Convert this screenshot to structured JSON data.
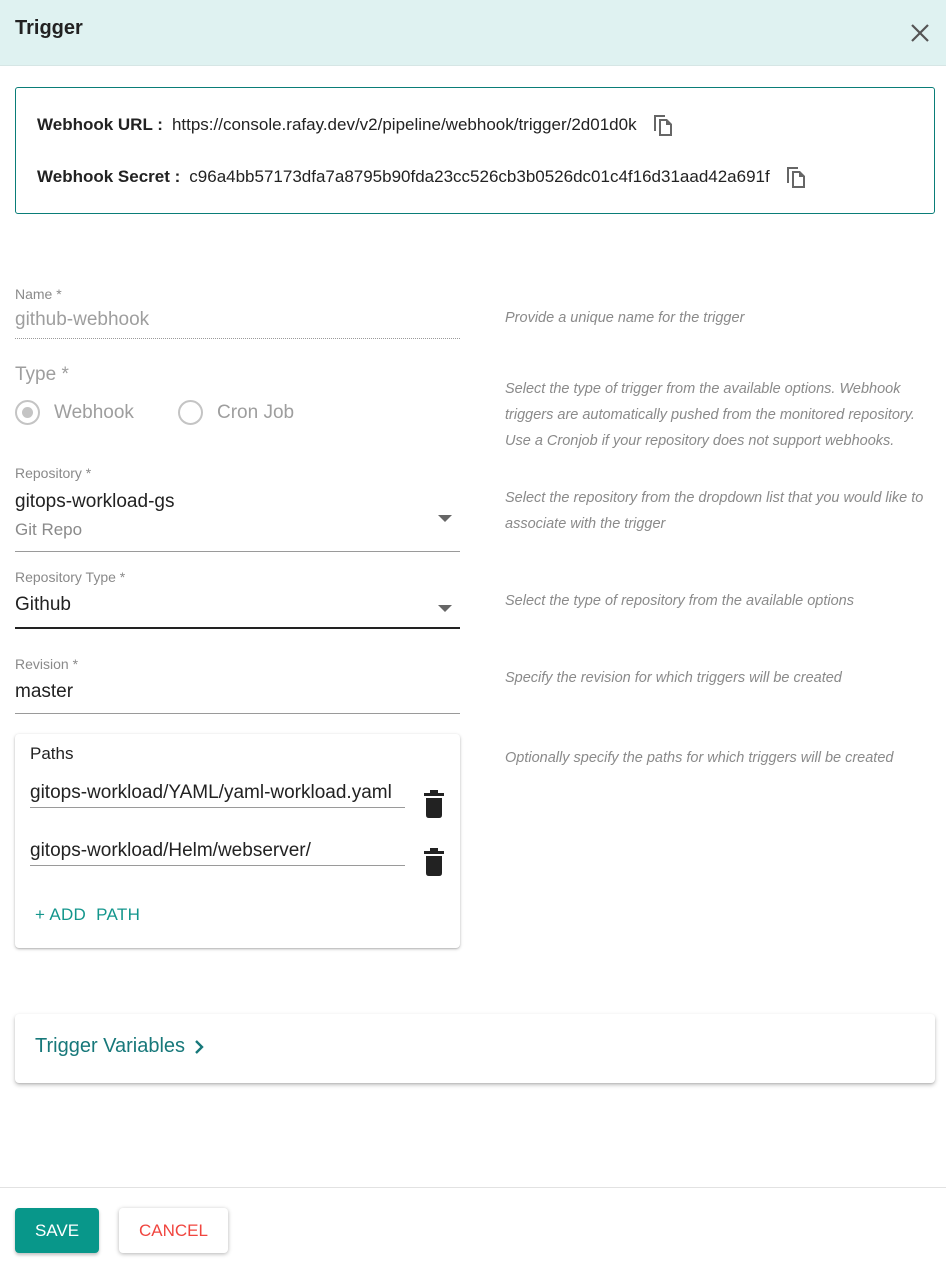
{
  "header": {
    "title": "Trigger",
    "close_icon": "close-icon"
  },
  "webhook": {
    "url_label": "Webhook URL :",
    "url_value": "https://console.rafay.dev/v2/pipeline/webhook/trigger/2d01d0k",
    "secret_label": "Webhook Secret :",
    "secret_value": "c96a4bb57173dfa7a8795b90fda23cc526cb3b0526dc01c4f16d31aad42a691f",
    "copy_icon": "copy-icon"
  },
  "form": {
    "name": {
      "label": "Name *",
      "value": "github-webhook",
      "help": "Provide a unique name for the trigger"
    },
    "type": {
      "label": "Type *",
      "options": [
        {
          "label": "Webhook",
          "checked": true
        },
        {
          "label": "Cron Job",
          "checked": false
        }
      ],
      "help": "Select the type of trigger from the available options. Webhook triggers are automatically pushed from the monitored repository. Use a Cronjob if your repository does not support webhooks."
    },
    "repository": {
      "label": "Repository *",
      "value": "gitops-workload-gs",
      "subvalue": "Git Repo",
      "help": "Select the repository from the dropdown list that you would like to associate with the trigger"
    },
    "repository_type": {
      "label": "Repository Type *",
      "value": "Github",
      "help": "Select the type of repository from the available options"
    },
    "revision": {
      "label": "Revision *",
      "value": "master",
      "help": "Specify the revision for which triggers will be created"
    },
    "paths": {
      "title": "Paths",
      "items": [
        "gitops-workload/YAML/yaml-workload.yaml",
        "gitops-workload/Helm/webserver/"
      ],
      "add_label": "+ ADD  PATH",
      "delete_icon": "trash-icon",
      "help": "Optionally specify the paths for which triggers will be created"
    }
  },
  "trigger_variables": {
    "label": "Trigger Variables",
    "icon": "chevron-right-icon"
  },
  "footer": {
    "save_label": "SAVE",
    "cancel_label": "CANCEL"
  },
  "colors": {
    "accent": "#08978a",
    "header_bg": "#dff2f1",
    "cancel": "#f0453f",
    "link": "#17787a"
  }
}
